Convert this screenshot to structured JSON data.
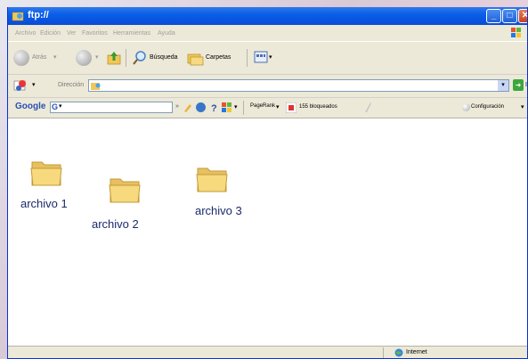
{
  "window": {
    "title": "ftp://"
  },
  "menu": {
    "items": [
      "Archivo",
      "Edición",
      "Ver",
      "Favoritos",
      "Herramientas",
      "Ayuda"
    ]
  },
  "toolbar": {
    "back_label": "Atrás",
    "search_label": "Búsqueda",
    "folders_label": "Carpetas"
  },
  "address": {
    "label": "Dirección",
    "value": "",
    "go_label": "Ir"
  },
  "google": {
    "logo": "Google",
    "pagerank_label": "PageRank",
    "blocked_label": "155 bloqueados",
    "settings_label": "Configuración"
  },
  "files": [
    {
      "name": "archivo 1"
    },
    {
      "name": "archivo 2"
    },
    {
      "name": "archivo 3"
    }
  ],
  "status": {
    "zone": "Internet"
  },
  "colors": {
    "titlebar": "#0a5fe8",
    "folder": "#f5d57a",
    "chrome": "#ece9d8",
    "label": "#1a2a6c"
  }
}
